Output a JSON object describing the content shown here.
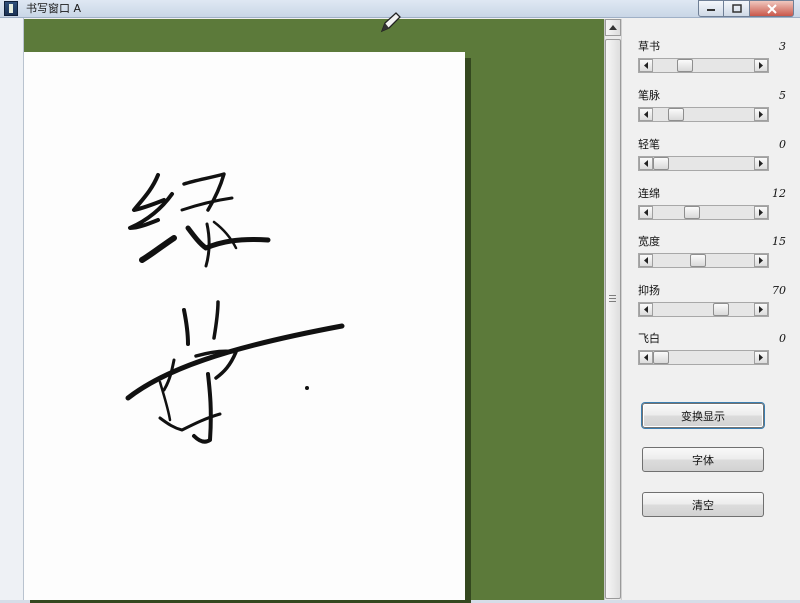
{
  "window": {
    "title": "书写窗口 A"
  },
  "sliders": [
    {
      "label": "草书",
      "value": "3",
      "level": 0.28
    },
    {
      "label": "笔脉",
      "value": "5",
      "level": 0.18
    },
    {
      "label": "轻笔",
      "value": "0",
      "level": 0.0
    },
    {
      "label": "连绵",
      "value": "12",
      "level": 0.36
    },
    {
      "label": "宽度",
      "value": "15",
      "level": 0.44
    },
    {
      "label": "抑扬",
      "value": "70",
      "level": 0.7
    },
    {
      "label": "飞白",
      "value": "0",
      "level": 0.0
    }
  ],
  "buttons": {
    "toggle_display": "变换显示",
    "font": "字体",
    "clear": "清空"
  },
  "colors": {
    "desk": "#5c7a3a",
    "paper": "#fdfdfd",
    "ink": "#111111"
  }
}
